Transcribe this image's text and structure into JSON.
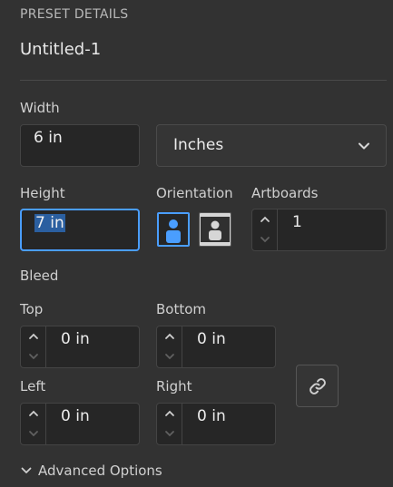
{
  "section_title": "PRESET DETAILS",
  "preset_name": "Untitled-1",
  "width": {
    "label": "Width",
    "value": "6 in"
  },
  "units": {
    "value": "Inches",
    "icon": "chevron-down-icon"
  },
  "height": {
    "label": "Height",
    "value": "7 in"
  },
  "orientation": {
    "label": "Orientation",
    "selected": "portrait"
  },
  "artboards": {
    "label": "Artboards",
    "value": "1"
  },
  "bleed": {
    "label": "Bleed",
    "top": {
      "label": "Top",
      "value": "0 in"
    },
    "bottom": {
      "label": "Bottom",
      "value": "0 in"
    },
    "left": {
      "label": "Left",
      "value": "0 in"
    },
    "right": {
      "label": "Right",
      "value": "0 in"
    },
    "link_icon": "link-icon"
  },
  "advanced_options": {
    "label": "Advanced Options",
    "icon": "chevron-down-icon"
  },
  "colors": {
    "accent": "#4a9eff",
    "background": "#323232"
  }
}
